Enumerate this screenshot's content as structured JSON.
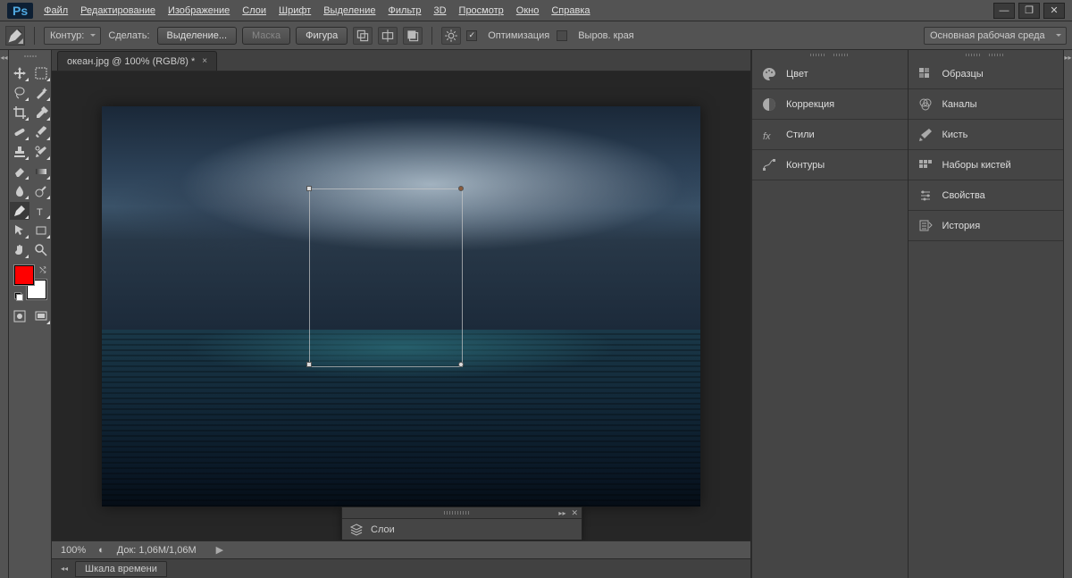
{
  "app": {
    "logo": "Ps"
  },
  "menu": [
    "Файл",
    "Редактирование",
    "Изображение",
    "Слои",
    "Шрифт",
    "Выделение",
    "Фильтр",
    "3D",
    "Просмотр",
    "Окно",
    "Справка"
  ],
  "options": {
    "contour_label": "Контур:",
    "make_label": "Сделать:",
    "selection_btn": "Выделение...",
    "mask_btn": "Маска",
    "shape_btn": "Фигура",
    "optimize_label": "Оптимизация",
    "align_edges_label": "Выров. края",
    "workspace": "Основная рабочая среда"
  },
  "document": {
    "tab_title": "океан.jpg @ 100% (RGB/8) *",
    "zoom": "100%",
    "doc_size": "Док: 1,06M/1,06M",
    "timeline_tab": "Шкала времени"
  },
  "swatch": {
    "fg": "#ff0000",
    "bg": "#ffffff"
  },
  "panels_left": [
    {
      "id": "color",
      "label": "Цвет"
    },
    {
      "id": "adjust",
      "label": "Коррекция"
    },
    {
      "id": "styles",
      "label": "Стили"
    },
    {
      "id": "paths",
      "label": "Контуры"
    }
  ],
  "panels_right": [
    {
      "id": "samples",
      "label": "Образцы"
    },
    {
      "id": "channels",
      "label": "Каналы"
    },
    {
      "id": "brush",
      "label": "Кисть"
    },
    {
      "id": "brushsets",
      "label": "Наборы кистей"
    },
    {
      "id": "props",
      "label": "Свойства"
    },
    {
      "id": "history",
      "label": "История"
    }
  ],
  "float_panel": {
    "title": "Слои"
  }
}
